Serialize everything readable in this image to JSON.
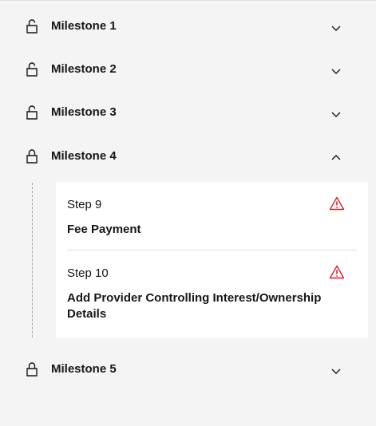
{
  "milestones": [
    {
      "label": "Milestone 1",
      "lock_icon": "unlocked-icon",
      "chevron": "chevron-down-icon",
      "expanded": false
    },
    {
      "label": "Milestone 2",
      "lock_icon": "unlocked-icon",
      "chevron": "chevron-down-icon",
      "expanded": false
    },
    {
      "label": "Milestone 3",
      "lock_icon": "unlocked-icon",
      "chevron": "chevron-down-icon",
      "expanded": false
    },
    {
      "label": "Milestone 4",
      "lock_icon": "locked-icon",
      "chevron": "chevron-up-icon",
      "expanded": true
    },
    {
      "label": "Milestone 5",
      "lock_icon": "locked-icon",
      "chevron": "chevron-down-icon",
      "expanded": false
    }
  ],
  "steps": [
    {
      "number": "Step 9",
      "title": "Fee Payment",
      "status_icon": "warning-icon"
    },
    {
      "number": "Step 10",
      "title": "Add Provider Controlling Interest/Ownership Details",
      "status_icon": "warning-icon"
    }
  ],
  "colors": {
    "background": "#f4f4f4",
    "card": "#ffffff",
    "text": "#161616",
    "warning": "#da1e28",
    "rail": "#a8a8a8"
  }
}
